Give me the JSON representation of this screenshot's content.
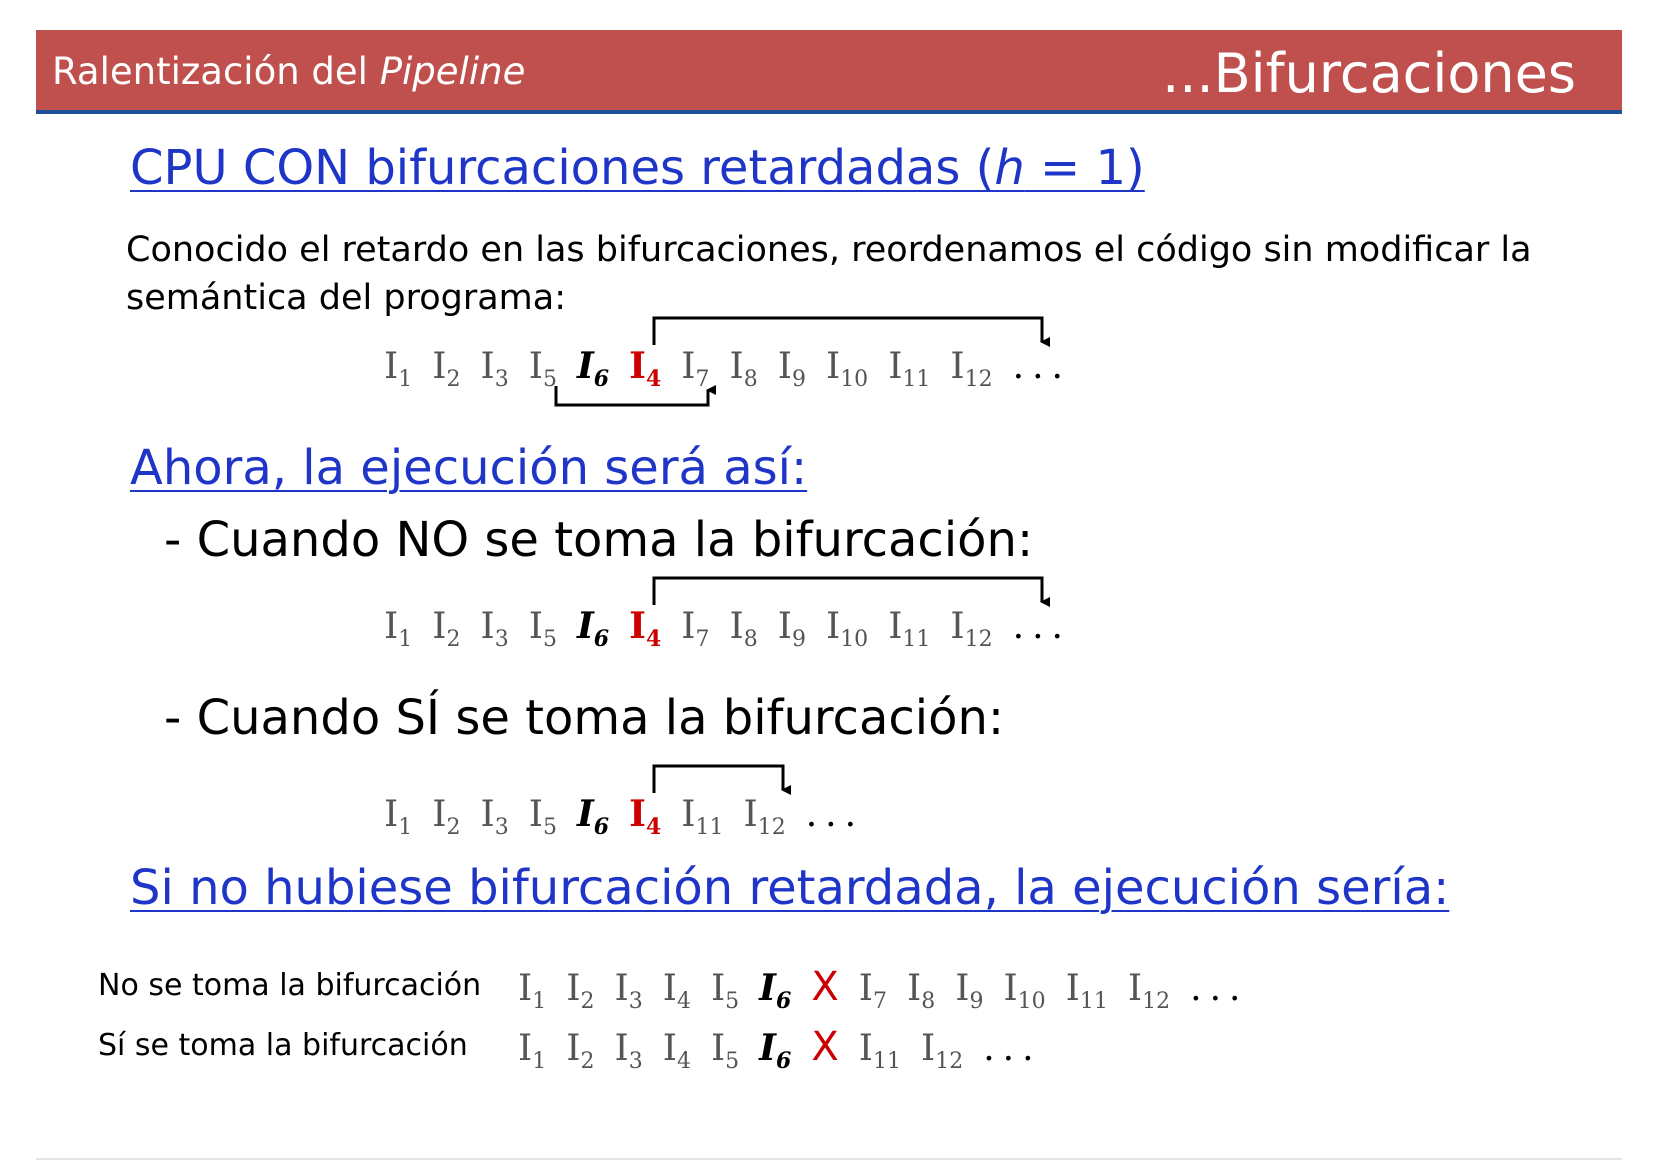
{
  "header": {
    "left_prefix": "Ralentización del ",
    "left_italic": "Pipeline",
    "right": "...Bifurcaciones",
    "bg_color": "#c0504d",
    "rule_color": "#1f4e9a"
  },
  "section1": {
    "title_prefix": "CPU CON bifurcaciones retardadas (",
    "title_italic": "h",
    "title_suffix": " = 1)",
    "paragraph": "Conocido el retardo en las bifurcaciones, reordenamos el código sin modificar la semántica del programa:"
  },
  "section2": {
    "title": "Ahora, la ejecución será así:",
    "case_no": "- Cuando NO se toma la bifurcación:",
    "case_si": "- Cuando SÍ se toma la bifurcación:"
  },
  "section3": {
    "title": "Si no hubiese bifurcación retardada, la ejecución sería:",
    "row_no_label": "No se toma la bifurcación",
    "row_si_label": "Sí se toma la bifurcación"
  },
  "sequences": {
    "reordered": [
      {
        "letter": "I",
        "sub": "1",
        "style": "n"
      },
      {
        "letter": "I",
        "sub": "2",
        "style": "n"
      },
      {
        "letter": "I",
        "sub": "3",
        "style": "n"
      },
      {
        "letter": "I",
        "sub": "5",
        "style": "n"
      },
      {
        "letter": "I",
        "sub": "6",
        "style": "b"
      },
      {
        "letter": "I",
        "sub": "4",
        "style": "r"
      },
      {
        "letter": "I",
        "sub": "7",
        "style": "n"
      },
      {
        "letter": "I",
        "sub": "8",
        "style": "n"
      },
      {
        "letter": "I",
        "sub": "9",
        "style": "n"
      },
      {
        "letter": "I",
        "sub": "10",
        "style": "n"
      },
      {
        "letter": "I",
        "sub": "11",
        "style": "n"
      },
      {
        "letter": "I",
        "sub": "12",
        "style": "n"
      },
      {
        "letter": "...",
        "sub": "",
        "style": "dots"
      }
    ],
    "not_taken": [
      {
        "letter": "I",
        "sub": "1",
        "style": "n"
      },
      {
        "letter": "I",
        "sub": "2",
        "style": "n"
      },
      {
        "letter": "I",
        "sub": "3",
        "style": "n"
      },
      {
        "letter": "I",
        "sub": "5",
        "style": "n"
      },
      {
        "letter": "I",
        "sub": "6",
        "style": "b"
      },
      {
        "letter": "I",
        "sub": "4",
        "style": "r"
      },
      {
        "letter": "I",
        "sub": "7",
        "style": "n"
      },
      {
        "letter": "I",
        "sub": "8",
        "style": "n"
      },
      {
        "letter": "I",
        "sub": "9",
        "style": "n"
      },
      {
        "letter": "I",
        "sub": "10",
        "style": "n"
      },
      {
        "letter": "I",
        "sub": "11",
        "style": "n"
      },
      {
        "letter": "I",
        "sub": "12",
        "style": "n"
      },
      {
        "letter": "...",
        "sub": "",
        "style": "dots"
      }
    ],
    "taken": [
      {
        "letter": "I",
        "sub": "1",
        "style": "n"
      },
      {
        "letter": "I",
        "sub": "2",
        "style": "n"
      },
      {
        "letter": "I",
        "sub": "3",
        "style": "n"
      },
      {
        "letter": "I",
        "sub": "5",
        "style": "n"
      },
      {
        "letter": "I",
        "sub": "6",
        "style": "b"
      },
      {
        "letter": "I",
        "sub": "4",
        "style": "r"
      },
      {
        "letter": "I",
        "sub": "11",
        "style": "n"
      },
      {
        "letter": "I",
        "sub": "12",
        "style": "n"
      },
      {
        "letter": "...",
        "sub": "",
        "style": "dots"
      }
    ],
    "no_delay_not_taken": [
      {
        "letter": "I",
        "sub": "1",
        "style": "n"
      },
      {
        "letter": "I",
        "sub": "2",
        "style": "n"
      },
      {
        "letter": "I",
        "sub": "3",
        "style": "n"
      },
      {
        "letter": "I",
        "sub": "4",
        "style": "n"
      },
      {
        "letter": "I",
        "sub": "5",
        "style": "n"
      },
      {
        "letter": "I",
        "sub": "6",
        "style": "b"
      },
      {
        "letter": "X",
        "sub": "",
        "style": "x"
      },
      {
        "letter": "I",
        "sub": "7",
        "style": "n"
      },
      {
        "letter": "I",
        "sub": "8",
        "style": "n"
      },
      {
        "letter": "I",
        "sub": "9",
        "style": "n"
      },
      {
        "letter": "I",
        "sub": "10",
        "style": "n"
      },
      {
        "letter": "I",
        "sub": "11",
        "style": "n"
      },
      {
        "letter": "I",
        "sub": "12",
        "style": "n"
      },
      {
        "letter": "...",
        "sub": "",
        "style": "dots"
      }
    ],
    "no_delay_taken": [
      {
        "letter": "I",
        "sub": "1",
        "style": "n"
      },
      {
        "letter": "I",
        "sub": "2",
        "style": "n"
      },
      {
        "letter": "I",
        "sub": "3",
        "style": "n"
      },
      {
        "letter": "I",
        "sub": "4",
        "style": "n"
      },
      {
        "letter": "I",
        "sub": "5",
        "style": "n"
      },
      {
        "letter": "I",
        "sub": "6",
        "style": "b"
      },
      {
        "letter": "X",
        "sub": "",
        "style": "x"
      },
      {
        "letter": "I",
        "sub": "11",
        "style": "n"
      },
      {
        "letter": "I",
        "sub": "12",
        "style": "n"
      },
      {
        "letter": "...",
        "sub": "",
        "style": "dots"
      }
    ]
  },
  "colors": {
    "title_blue": "#1f35c8",
    "highlight_red": "#cc0000"
  }
}
